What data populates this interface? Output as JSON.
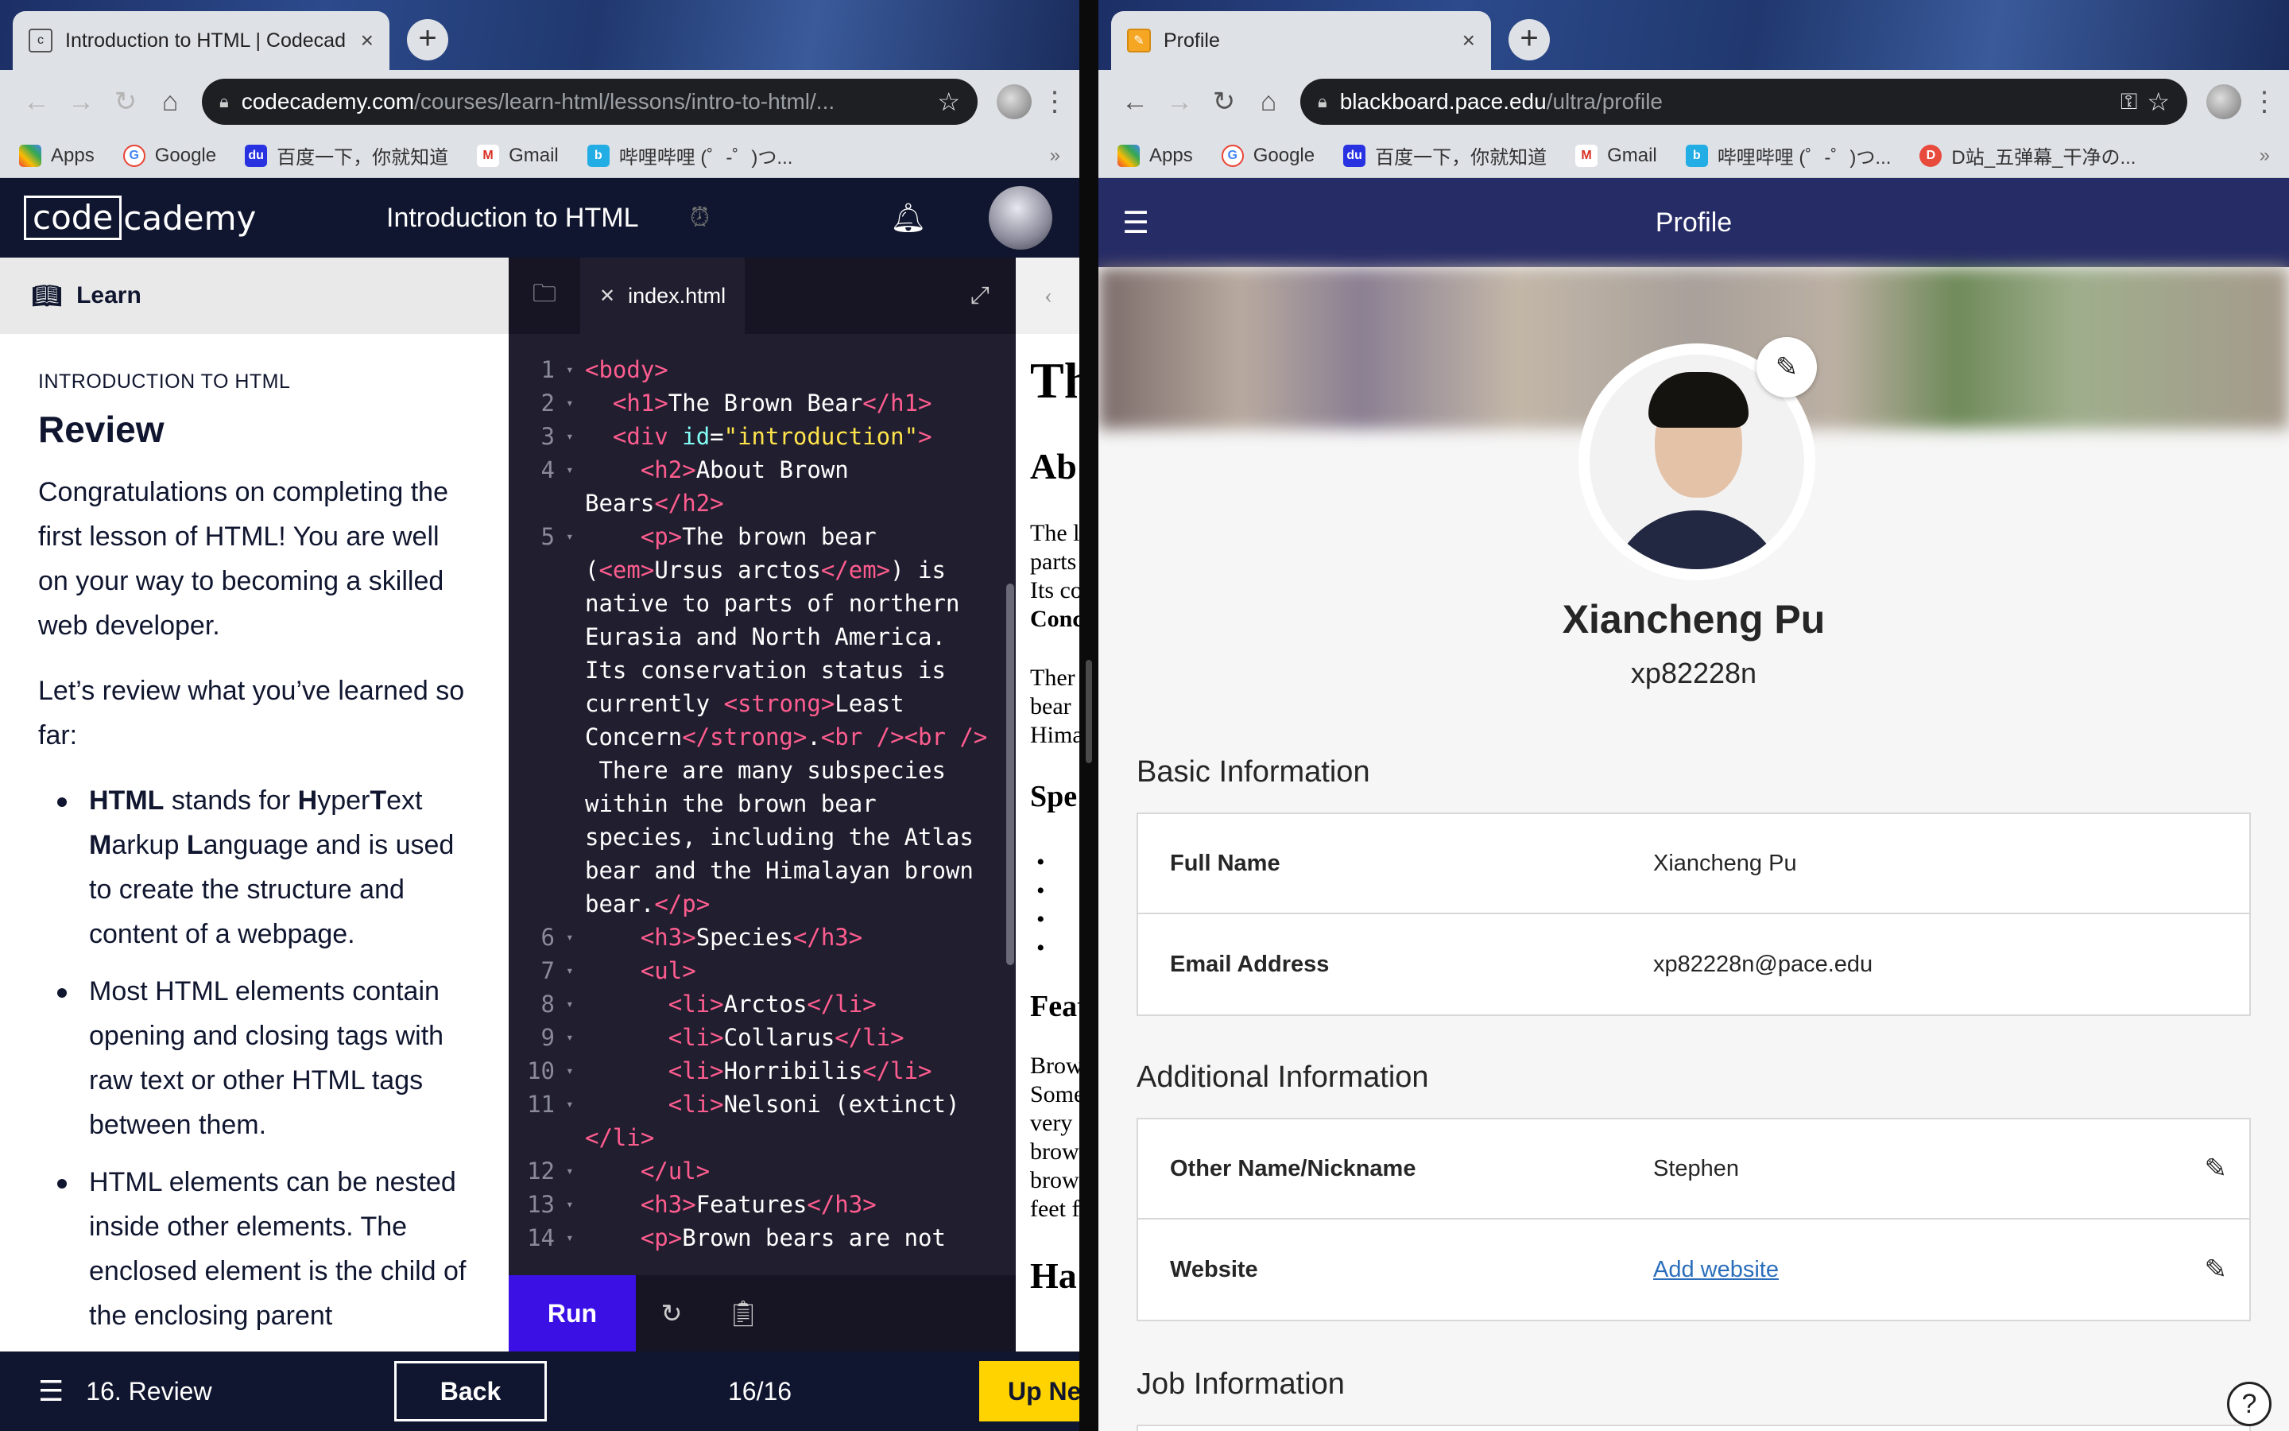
{
  "left_browser": {
    "tab_title": "Introduction to HTML | Codecad",
    "url_host": "codecademy.com",
    "url_path": "/courses/learn-html/lessons/intro-to-html/...",
    "bookmarks": [
      "Apps",
      "Google",
      "百度一下，你就知道",
      "Gmail",
      "哔哩哔哩 (゜-゜)つ..."
    ]
  },
  "codecademy": {
    "logo_box": "code",
    "logo_rest": "cademy",
    "course_title": "Introduction to HTML",
    "learn_label": "Learn",
    "eyebrow": "INTRODUCTION TO HTML",
    "heading": "Review",
    "para1": "Congratulations on completing the first lesson of HTML! You are well on your way to becoming a skilled web developer.",
    "para2": "Let’s review what you’ve learned so far:",
    "file_tab": "index.html",
    "run_label": "Run",
    "footer_lesson": "16. Review",
    "back_label": "Back",
    "progress": "16/16",
    "next_label": "Up Ne",
    "preview_lines": [
      "Th",
      "Ab",
      "The l",
      "parts",
      "Its co",
      "Conc",
      "Ther",
      "bear",
      "Hima",
      "Spe",
      "Feat",
      "Brow",
      "Some",
      "very",
      "brow",
      "brow",
      "feet f",
      "Ha"
    ]
  },
  "code_lines": [
    {
      "ln": "1",
      "parts": [
        [
          "t",
          "<body>"
        ]
      ]
    },
    {
      "ln": "2",
      "parts": [
        [
          "p",
          "  "
        ],
        [
          "t",
          "<h1>"
        ],
        [
          "p",
          "The Brown Bear"
        ],
        [
          "t",
          "</h1>"
        ]
      ]
    },
    {
      "ln": "3",
      "parts": [
        [
          "p",
          "  "
        ],
        [
          "t",
          "<div "
        ],
        [
          "a",
          "id"
        ],
        [
          "p",
          "="
        ],
        [
          "s",
          "\"introduction\""
        ],
        [
          "t",
          ">"
        ]
      ]
    },
    {
      "ln": "4",
      "parts": [
        [
          "p",
          "    "
        ],
        [
          "t",
          "<h2>"
        ],
        [
          "p",
          "About Brown"
        ]
      ]
    },
    {
      "ln": "",
      "parts": [
        [
          "p",
          "Bears"
        ],
        [
          "t",
          "</h2>"
        ]
      ]
    },
    {
      "ln": "5",
      "parts": [
        [
          "p",
          "    "
        ],
        [
          "t",
          "<p>"
        ],
        [
          "p",
          "The brown bear"
        ]
      ]
    },
    {
      "ln": "",
      "parts": [
        [
          "p",
          "("
        ],
        [
          "t",
          "<em>"
        ],
        [
          "p",
          "Ursus arctos"
        ],
        [
          "t",
          "</em>"
        ],
        [
          "p",
          ") is"
        ]
      ]
    },
    {
      "ln": "",
      "parts": [
        [
          "p",
          "native to parts of northern"
        ]
      ]
    },
    {
      "ln": "",
      "parts": [
        [
          "p",
          "Eurasia and North America."
        ]
      ]
    },
    {
      "ln": "",
      "parts": [
        [
          "p",
          "Its conservation status is"
        ]
      ]
    },
    {
      "ln": "",
      "parts": [
        [
          "p",
          "currently "
        ],
        [
          "t",
          "<strong>"
        ],
        [
          "p",
          "Least"
        ]
      ]
    },
    {
      "ln": "",
      "parts": [
        [
          "p",
          "Concern"
        ],
        [
          "t",
          "</strong>"
        ],
        [
          "p",
          "."
        ],
        [
          "t",
          "<br />"
        ],
        [
          "t",
          "<br />"
        ]
      ]
    },
    {
      "ln": "",
      "parts": [
        [
          "p",
          " There are many subspecies"
        ]
      ]
    },
    {
      "ln": "",
      "parts": [
        [
          "p",
          "within the brown bear"
        ]
      ]
    },
    {
      "ln": "",
      "parts": [
        [
          "p",
          "species, including the Atlas"
        ]
      ]
    },
    {
      "ln": "",
      "parts": [
        [
          "p",
          "bear and the Himalayan brown"
        ]
      ]
    },
    {
      "ln": "",
      "parts": [
        [
          "p",
          "bear."
        ],
        [
          "t",
          "</p>"
        ]
      ]
    },
    {
      "ln": "6",
      "parts": [
        [
          "p",
          "    "
        ],
        [
          "t",
          "<h3>"
        ],
        [
          "p",
          "Species"
        ],
        [
          "t",
          "</h3>"
        ]
      ]
    },
    {
      "ln": "7",
      "parts": [
        [
          "p",
          "    "
        ],
        [
          "t",
          "<ul>"
        ]
      ]
    },
    {
      "ln": "8",
      "parts": [
        [
          "p",
          "      "
        ],
        [
          "t",
          "<li>"
        ],
        [
          "p",
          "Arctos"
        ],
        [
          "t",
          "</li>"
        ]
      ]
    },
    {
      "ln": "9",
      "parts": [
        [
          "p",
          "      "
        ],
        [
          "t",
          "<li>"
        ],
        [
          "p",
          "Collarus"
        ],
        [
          "t",
          "</li>"
        ]
      ]
    },
    {
      "ln": "10",
      "parts": [
        [
          "p",
          "      "
        ],
        [
          "t",
          "<li>"
        ],
        [
          "p",
          "Horribilis"
        ],
        [
          "t",
          "</li>"
        ]
      ]
    },
    {
      "ln": "11",
      "parts": [
        [
          "p",
          "      "
        ],
        [
          "t",
          "<li>"
        ],
        [
          "p",
          "Nelsoni (extinct)"
        ]
      ]
    },
    {
      "ln": "",
      "parts": [
        [
          "t",
          "</li>"
        ]
      ]
    },
    {
      "ln": "12",
      "parts": [
        [
          "p",
          "    "
        ],
        [
          "t",
          "</ul>"
        ]
      ]
    },
    {
      "ln": "13",
      "parts": [
        [
          "p",
          "    "
        ],
        [
          "t",
          "<h3>"
        ],
        [
          "p",
          "Features"
        ],
        [
          "t",
          "</h3>"
        ]
      ]
    },
    {
      "ln": "14",
      "parts": [
        [
          "p",
          "    "
        ],
        [
          "t",
          "<p>"
        ],
        [
          "p",
          "Brown bears are not"
        ]
      ]
    }
  ],
  "right_browser": {
    "tab_title": "Profile",
    "url_host": "blackboard.pace.edu",
    "url_path": "/ultra/profile",
    "bookmarks": [
      "Apps",
      "Google",
      "百度一下，你就知道",
      "Gmail",
      "哔哩哔哩 (゜-゜)つ...",
      "D站_五弹幕_干净の..."
    ]
  },
  "blackboard": {
    "header_title": "Profile",
    "name": "Xiancheng Pu",
    "username": "xp82228n",
    "basic_title": "Basic Information",
    "full_name_label": "Full Name",
    "full_name_value": "Xiancheng Pu",
    "email_label": "Email Address",
    "email_value": "xp82228n@pace.edu",
    "additional_title": "Additional Information",
    "nickname_label": "Other Name/Nickname",
    "nickname_value": "Stephen",
    "website_label": "Website",
    "website_value": "Add website",
    "job_title": "Job Information"
  },
  "colors": {
    "codecademy_navy": "#10162f",
    "run_purple": "#3a10e5",
    "up_next_yellow": "#ffd300",
    "blackboard_header": "#262c66",
    "link_blue": "#2a6ebb"
  }
}
